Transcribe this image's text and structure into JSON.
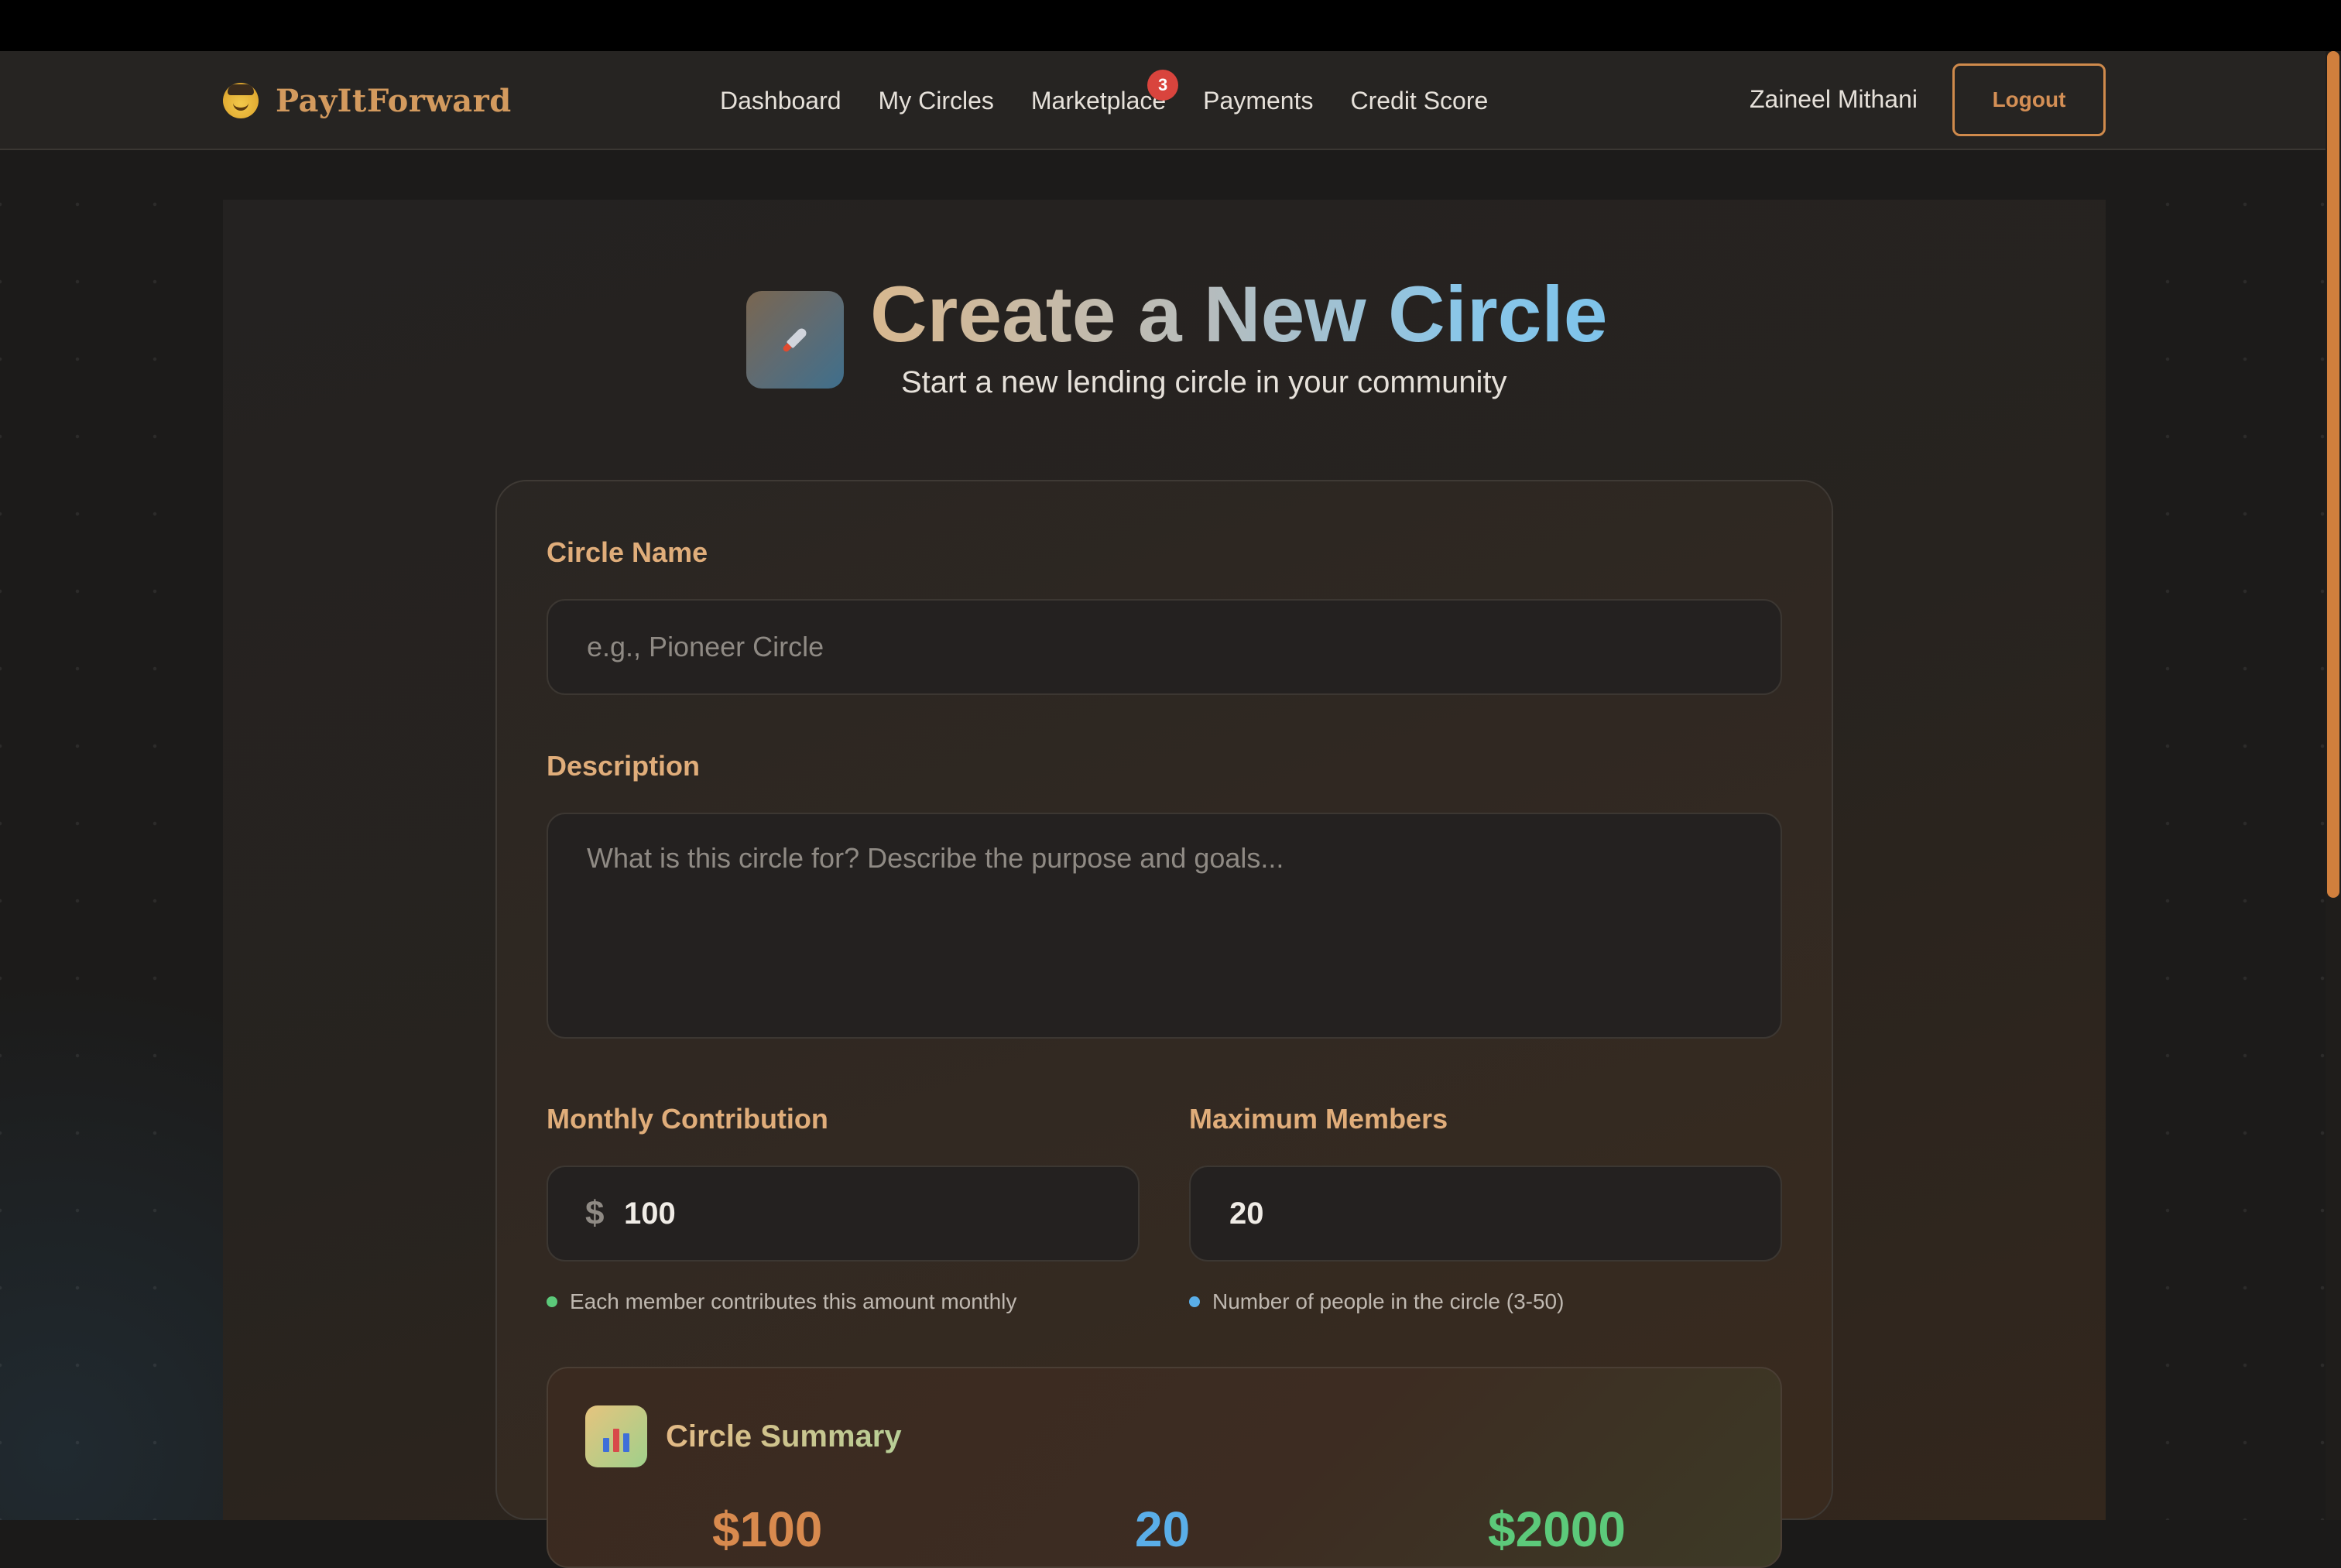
{
  "app": {
    "brand_name": "PayItForward",
    "brand_icon": "cowboy-emoji-icon"
  },
  "nav": {
    "links": [
      "Dashboard",
      "My Circles",
      "Marketplace",
      "Payments",
      "Credit Score"
    ],
    "marketplace_badge": "3",
    "user_name": "Zaineel Mithani",
    "logout_label": "Logout"
  },
  "page": {
    "title": "Create a New Circle",
    "subtitle": "Start a new lending circle in your community",
    "icon": "rocket-icon"
  },
  "form": {
    "circle_name": {
      "label": "Circle Name",
      "value": "",
      "placeholder": "e.g., Pioneer Circle"
    },
    "description": {
      "label": "Description",
      "value": "",
      "placeholder": "What is this circle for? Describe the purpose and goals..."
    },
    "monthly_contribution": {
      "label": "Monthly Contribution",
      "currency_symbol": "$",
      "value": "100",
      "hint": "Each member contributes this amount monthly"
    },
    "max_members": {
      "label": "Maximum Members",
      "value": "20",
      "hint": "Number of people in the circle (3-50)"
    }
  },
  "summary": {
    "title": "Circle Summary",
    "icon": "bar-chart-icon",
    "stats": [
      "$100",
      "20",
      "$2000"
    ]
  },
  "colors": {
    "accent": "#d39a5e",
    "label": "#e0ad7a",
    "badge": "#d9443d",
    "hint_green": "#5cc97a",
    "hint_blue": "#5aaee8"
  }
}
